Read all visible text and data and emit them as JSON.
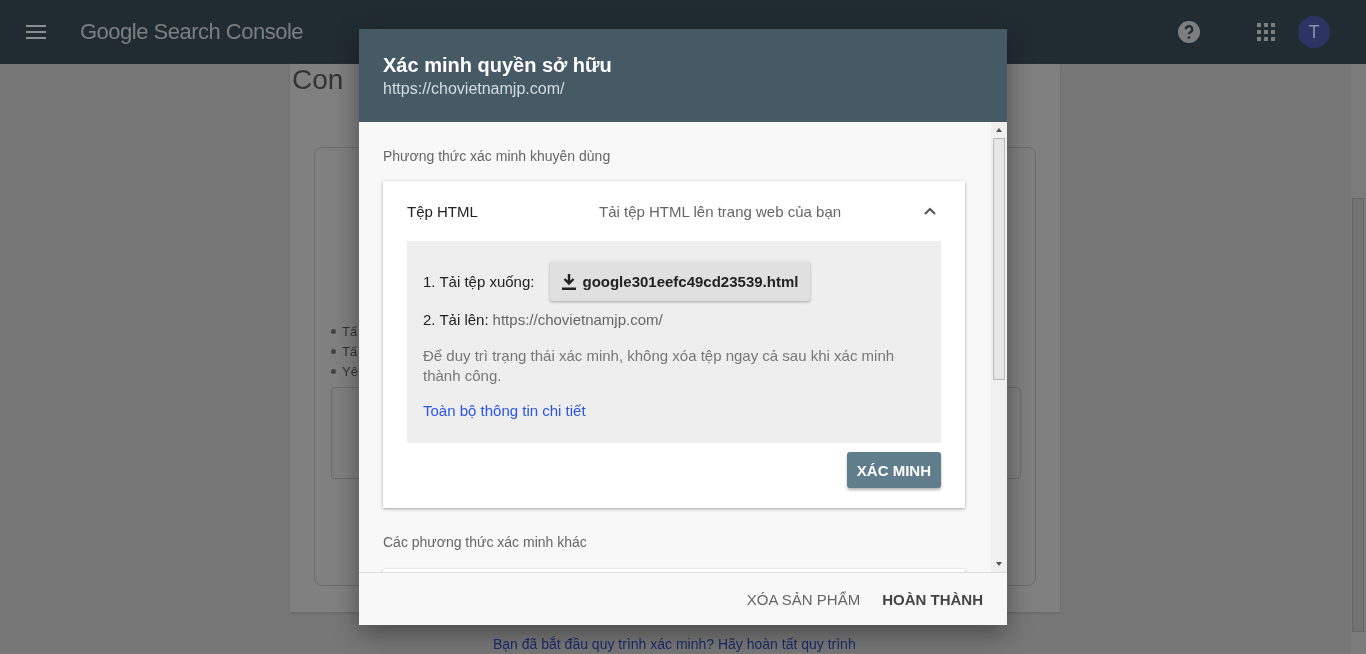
{
  "app_bar": {
    "title": "Google Search Console",
    "avatar_letter": "T"
  },
  "background": {
    "heading": "Con",
    "bullets": [
      "Tấ",
      "Tấ",
      "Yê"
    ],
    "link": "Bạn đã bắt đầu quy trình xác minh? Hãy hoàn tất quy trình"
  },
  "dialog": {
    "title": "Xác minh quyền sở hữu",
    "subtitle": "https://chovietnamjp.com/",
    "recommended_label": "Phương thức xác minh khuyên dùng",
    "method": {
      "name": "Tệp HTML",
      "description": "Tải tệp HTML lên trang web của bạn",
      "expanded": true,
      "step1_label": "1. Tải tệp xuống:",
      "file_button": "google301eefc49cd23539.html",
      "step2_label": "2. Tải lên:",
      "step2_url": "https://chovietnamjp.com/",
      "note": "Để duy trì trạng thái xác minh, không xóa tệp ngay cả sau khi xác minh thành công.",
      "details_link": "Toàn bộ thông tin chi tiết",
      "verify_button": "XÁC MINH"
    },
    "other_label": "Các phương thức xác minh khác",
    "buttons": [
      {
        "label": "XÓA SẢN PHẨM",
        "kind": "secondary"
      },
      {
        "label": "HOÀN THÀNH",
        "kind": "primary"
      }
    ]
  }
}
